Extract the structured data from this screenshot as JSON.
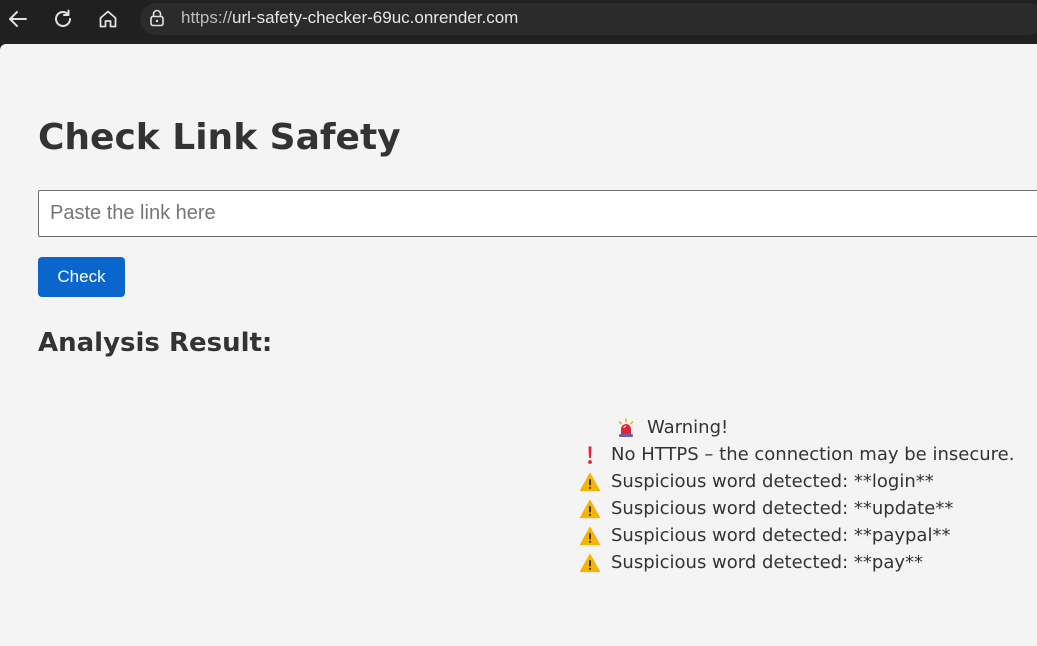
{
  "browser": {
    "url_scheme": "https://",
    "url_host": "url-safety-checker-69uc.onrender.com",
    "icons": [
      "back-icon",
      "reload-icon",
      "home-icon",
      "lock-icon"
    ]
  },
  "page": {
    "title": "Check Link Safety",
    "input": {
      "placeholder": "Paste the link here",
      "value": ""
    },
    "check_button_label": "Check",
    "result_heading": "Analysis Result:",
    "results": {
      "warning": {
        "icon": "siren-icon",
        "text": "Warning!"
      },
      "issues": [
        {
          "icon": "exclamation-icon",
          "text": "No HTTPS – the connection may be insecure."
        },
        {
          "icon": "warning-triangle-icon",
          "text": "Suspicious word detected: **login**"
        },
        {
          "icon": "warning-triangle-icon",
          "text": "Suspicious word detected: **update**"
        },
        {
          "icon": "warning-triangle-icon",
          "text": "Suspicious word detected: **paypal**"
        },
        {
          "icon": "warning-triangle-icon",
          "text": "Suspicious word detected: **pay**"
        }
      ]
    }
  },
  "colors": {
    "button_bg": "#0a66cc",
    "page_bg": "#f4f4f4",
    "chrome_bg": "#202020",
    "warning_yellow": "#f5b400",
    "alert_red": "#e0243a"
  }
}
